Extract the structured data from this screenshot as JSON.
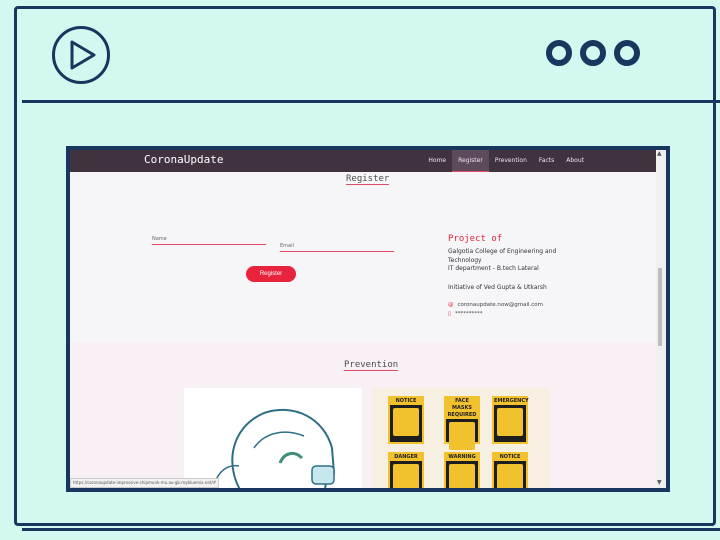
{
  "app": {
    "brand": "CoronaUpdate",
    "nav": [
      "Home",
      "Register",
      "Prevention",
      "Facts",
      "About"
    ],
    "active_nav": "Register"
  },
  "register": {
    "title": "Register",
    "name_placeholder": "Name",
    "email_placeholder": "Email",
    "button": "Register"
  },
  "project": {
    "title": "Project of",
    "line1": "Galgotia College of Engineering and Technology",
    "line2": "IT department - B.tech Lateral",
    "initiative": "Initiative of Ved Gupta & Utkarsh",
    "email": "coronaupdate.now@gmail.com",
    "phone": "**********"
  },
  "prevention": {
    "title": "Prevention",
    "signs": [
      "NOTICE",
      "FACE MASKS REQUIRED",
      "EMERGENCY",
      "WARNING",
      "DANGER",
      "",
      "NOTICE"
    ]
  },
  "status_url": "https://coronaupdate-impressive-chipmunk-mu.au-gb.mybluemix.net/#"
}
